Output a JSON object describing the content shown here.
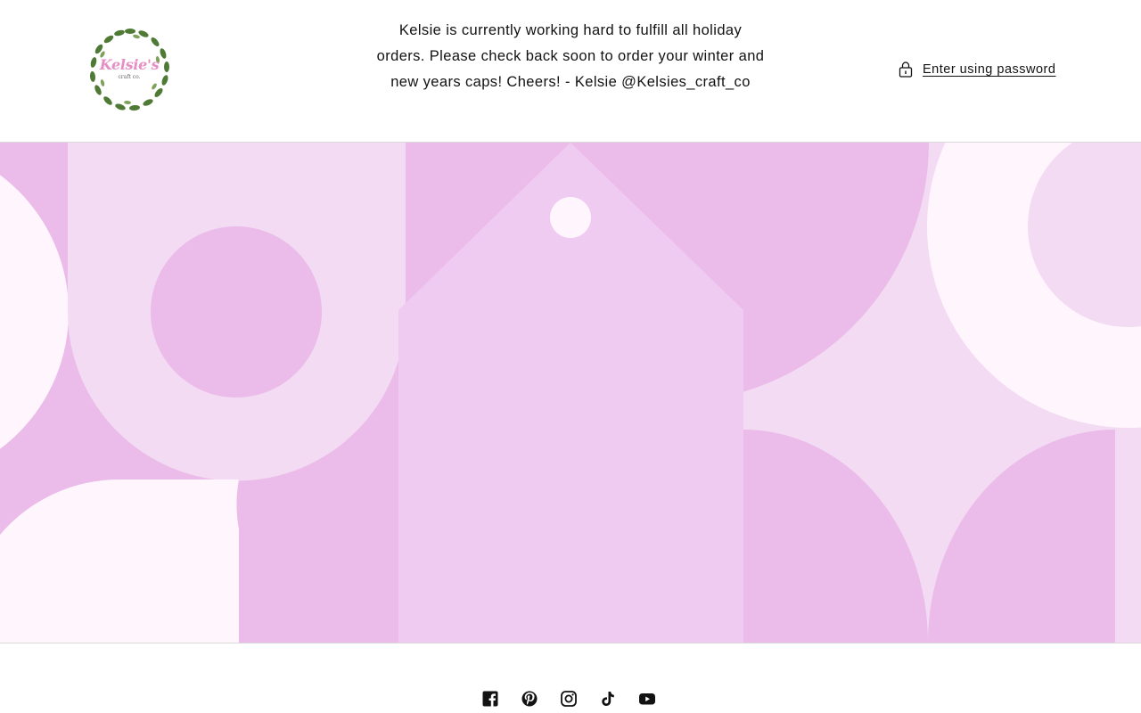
{
  "header": {
    "logo": {
      "icon": "leaf-wreath-logo",
      "brand_text": "Kelsie's",
      "sub_text": "craft co."
    },
    "announcement": "Kelsie is currently working hard to fulfill all holiday orders. Please check back soon to order your winter and new years caps! Cheers! - Kelsie @Kelsies_craft_co",
    "password_link": {
      "icon": "lock-icon",
      "label": "Enter using password"
    }
  },
  "hero": {
    "colors": {
      "background": "#ebbbe9",
      "light": "#f3dbf3",
      "lightest": "#fff6fd",
      "tag": "#f0cbf1"
    }
  },
  "footer": {
    "social": [
      {
        "name": "Facebook",
        "icon": "facebook-icon"
      },
      {
        "name": "Pinterest",
        "icon": "pinterest-icon"
      },
      {
        "name": "Instagram",
        "icon": "instagram-icon"
      },
      {
        "name": "TikTok",
        "icon": "tiktok-icon"
      },
      {
        "name": "YouTube",
        "icon": "youtube-icon"
      }
    ]
  }
}
